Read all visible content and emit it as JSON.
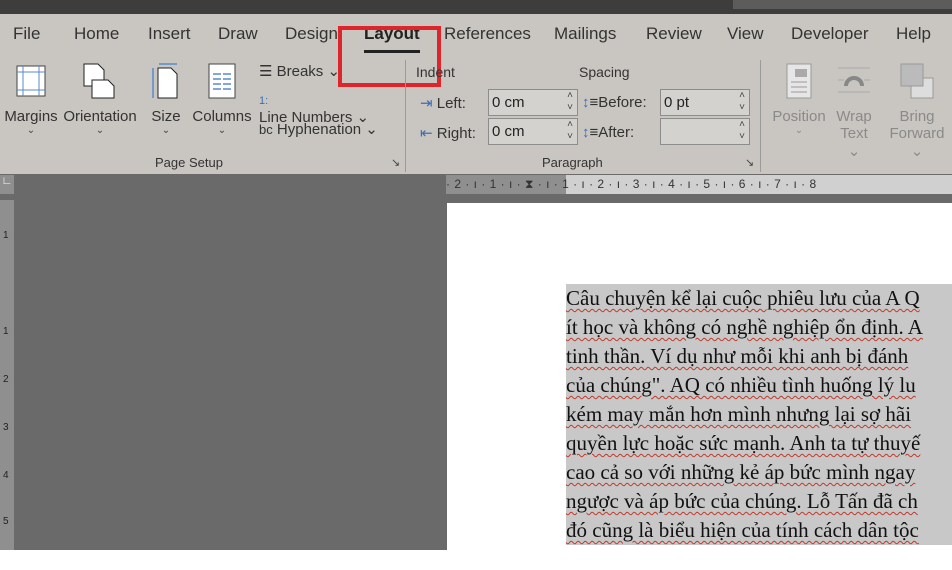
{
  "tabs": [
    "File",
    "Home",
    "Insert",
    "Draw",
    "Design",
    "Layout",
    "References",
    "Mailings",
    "Review",
    "View",
    "Developer",
    "Help"
  ],
  "active_tab": "Layout",
  "page_setup": {
    "margins": "Margins",
    "orientation": "Orientation",
    "size": "Size",
    "columns": "Columns",
    "breaks": "Breaks",
    "line_numbers": "Line Numbers",
    "hyphenation": "Hyphenation",
    "group_label": "Page Setup"
  },
  "paragraph": {
    "indent_label": "Indent",
    "spacing_label": "Spacing",
    "left_label": "Left:",
    "right_label": "Right:",
    "left_value": "0 cm",
    "right_value": "0 cm",
    "before_label": "Before:",
    "after_label": "After:",
    "before_value": "0 pt",
    "after_value": "",
    "group_label": "Paragraph"
  },
  "arrange": {
    "position": "Position",
    "wrap1": "Wrap",
    "wrap2": "Text",
    "bring1": "Bring",
    "bring2": "Forward"
  },
  "ruler": "· 2 · ı · 1 · ı · ⧗ · ı · 1 · ı · 2 · ı · 3 · ı · 4 · ı · 5 · ı · 6 · ı · 7 · ı · 8",
  "vruler": [
    "1",
    "·",
    "1",
    "2",
    "3",
    "4",
    "5"
  ],
  "document_lines": [
    "Câu chuyện kể lại cuộc phiêu lưu của A Q",
    "ít học và không có nghề nghiệp ổn định. A",
    "tinh thần. Ví dụ như mỗi khi anh bị đánh",
    "của chúng\". AQ có nhiều tình huống lý lu",
    "kém may mắn hơn mình nhưng lại sợ hãi",
    "quyền lực hoặc sức mạnh. Anh ta tự thuyế",
    "cao cả so với những kẻ áp bức mình ngay",
    "ngược và áp bức của chúng. Lỗ Tấn đã ch",
    "đó cũng là biểu hiện của tính cách dân tộc"
  ],
  "colors": {
    "highlight": "#e0242b",
    "ribbon": "#c9c6c1",
    "selection": "#c8c8c8"
  }
}
